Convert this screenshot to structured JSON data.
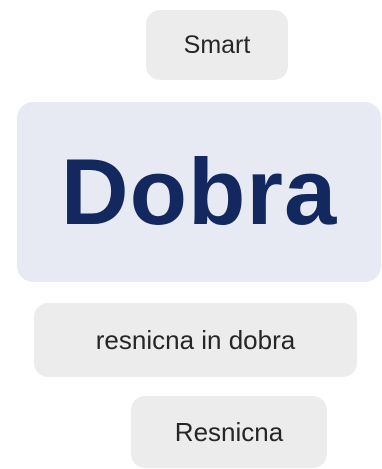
{
  "options": {
    "top_chip": "Smart",
    "featured_word": "Dobra",
    "middle_chip": "resnicna in dobra",
    "bottom_chip": "Resnicna"
  },
  "colors": {
    "chip_background": "#ececec",
    "card_background": "#e8eaf3",
    "featured_text": "#13285e",
    "chip_text": "#262626"
  }
}
